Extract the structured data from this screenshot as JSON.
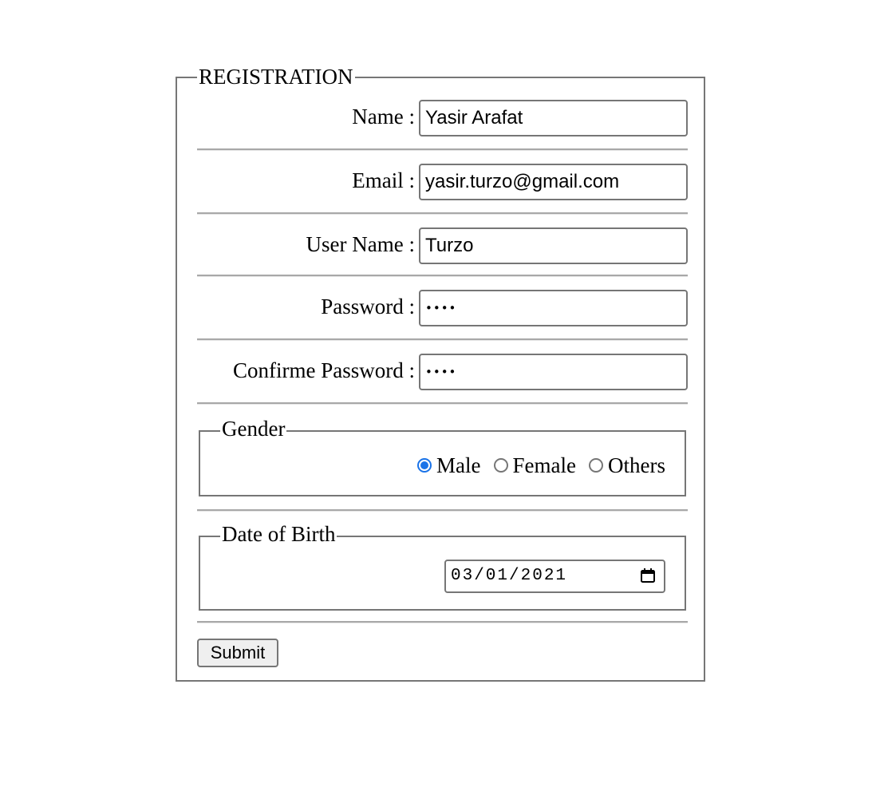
{
  "form": {
    "legend": "REGISTRATION",
    "fields": [
      {
        "label": "Name :",
        "value": "Yasir Arafat",
        "type": "text"
      },
      {
        "label": "Email :",
        "value": "yasir.turzo@gmail.com",
        "type": "text"
      },
      {
        "label": "User Name :",
        "value": "Turzo",
        "type": "text"
      },
      {
        "label": "Password :",
        "value": "••••",
        "type": "password"
      },
      {
        "label": "Confirme Password :",
        "value": "••••",
        "type": "password"
      }
    ],
    "gender": {
      "legend": "Gender",
      "options": [
        "Male",
        "Female",
        "Others"
      ],
      "selected": "Male",
      "accent_color": "#1a73e8"
    },
    "dob": {
      "legend": "Date of Birth",
      "value": "03/01/2021",
      "icon": "calendar-icon"
    },
    "submit_label": "Submit"
  }
}
